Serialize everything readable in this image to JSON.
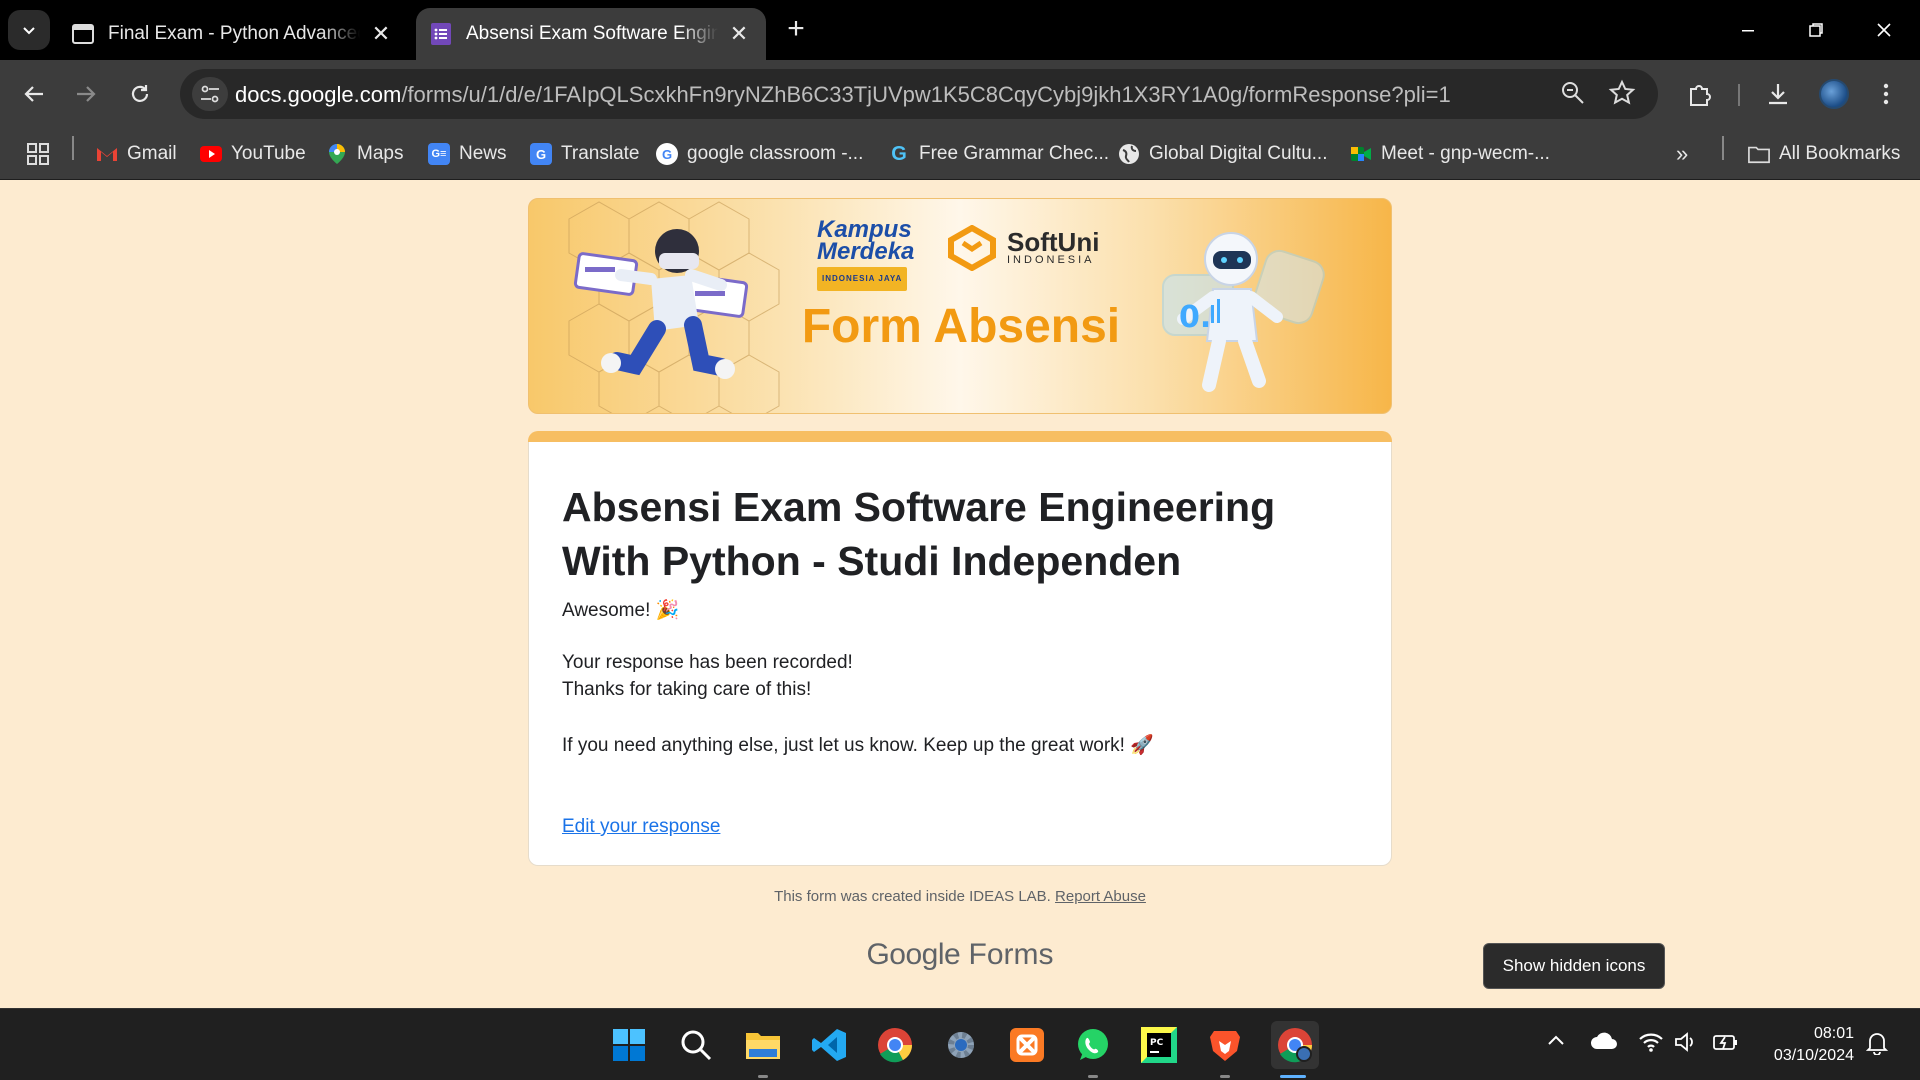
{
  "browser": {
    "tabs": [
      {
        "title": "Final Exam - Python Advanced (",
        "active": false
      },
      {
        "title": "Absensi Exam Software Enginee",
        "active": true
      }
    ],
    "url_host": "docs.google.com",
    "url_path": "/forms/u/1/d/e/1FAIpQLScxkhFn9ryNZhB6C33TjUVpw1K5C8CqyCybj9jkh1X3RY1A0g/formResponse?pli=1",
    "bookmarks": [
      {
        "label": "Gmail",
        "icon": "gmail-icon"
      },
      {
        "label": "YouTube",
        "icon": "youtube-icon"
      },
      {
        "label": "Maps",
        "icon": "maps-icon"
      },
      {
        "label": "News",
        "icon": "news-icon"
      },
      {
        "label": "Translate",
        "icon": "translate-icon"
      },
      {
        "label": "google classroom -...",
        "icon": "google-icon"
      },
      {
        "label": "Free Grammar Chec...",
        "icon": "grammar-icon"
      },
      {
        "label": "Global Digital Cultu...",
        "icon": "globe-icon"
      },
      {
        "label": "Meet - gnp-wecm-...",
        "icon": "meet-icon"
      }
    ],
    "all_bookmarks": "All Bookmarks"
  },
  "banner": {
    "logo1_line1": "Kampus",
    "logo1_line2": "Merdeka",
    "logo1_tag": "INDONESIA JAYA",
    "logo2_name": "SoftUni",
    "logo2_sub": "INDONESIA",
    "title": "Form Absensi"
  },
  "form": {
    "title": "Absensi Exam Software Engineering With Python - Studi Independen",
    "line1": "Awesome! 🎉",
    "line2": "Your response has been recorded!",
    "line3": "Thanks for taking care of this!",
    "line4": "If you need anything else, just let us know. Keep up the great work! 🚀",
    "edit_link": "Edit your response"
  },
  "footer": {
    "note": "This form was created inside IDEAS LAB.",
    "report": "Report Abuse",
    "brand_google": "Google",
    "brand_forms": "Forms"
  },
  "tooltip": "Show hidden icons",
  "taskbar": {
    "time": "08:01",
    "date": "03/10/2024"
  }
}
